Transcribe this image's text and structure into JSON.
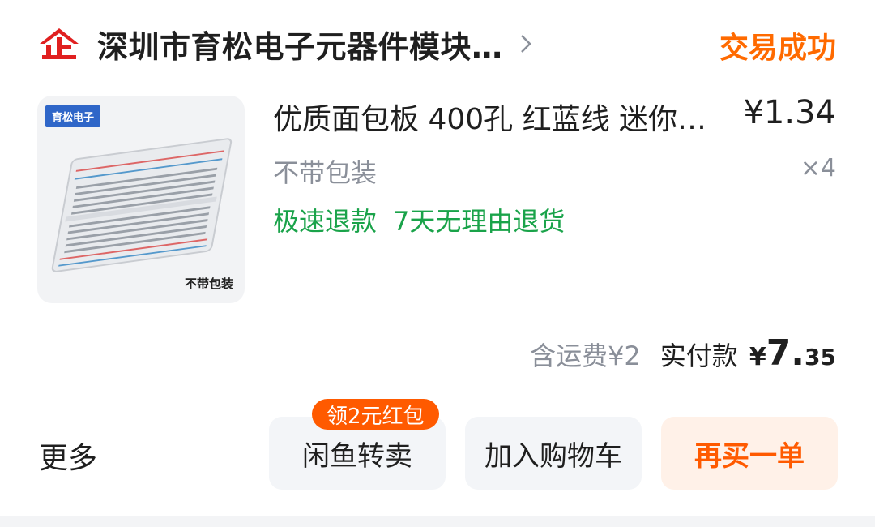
{
  "header": {
    "shop_icon": "enterprise-icon",
    "shop_icon_text": "企",
    "shop_name": "深圳市育松电子元器件模块…",
    "order_status": "交易成功"
  },
  "product": {
    "image_brand_label": "育松电子",
    "image_caption": "不带包装",
    "title": "优质面包板 400孔 红蓝线 迷你…",
    "price": "¥1.34",
    "sku": "不带包装",
    "quantity": "×4",
    "tags": [
      "极速退款",
      "7天无理由退货"
    ]
  },
  "totals": {
    "shipping": "含运费¥2",
    "paid_label": "实付款",
    "currency": "¥",
    "paid_int": "7.",
    "paid_dec": "35"
  },
  "actions": {
    "more": "更多",
    "resell": "闲鱼转卖",
    "resell_badge": "领2元红包",
    "add_to_cart": "加入购物车",
    "buy_again": "再买一单"
  },
  "colors": {
    "status_orange": "#ff6a00",
    "tag_green": "#1aa34a",
    "brand_red": "#e02020",
    "cta_orange": "#ff5a00"
  }
}
